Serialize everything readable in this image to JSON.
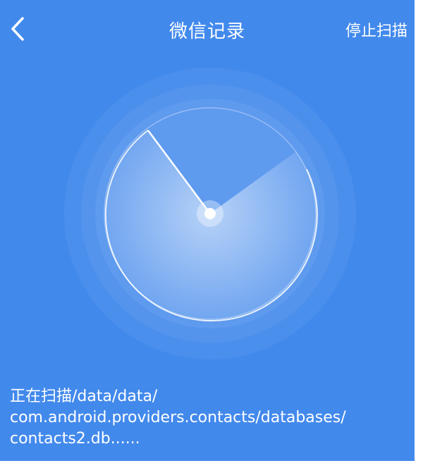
{
  "header": {
    "back_icon": "chevron-left-icon",
    "title": "微信记录",
    "stop_label": "停止扫描"
  },
  "radar": {
    "icon": "radar-scan-icon"
  },
  "status": {
    "line1": "正在扫描/data/data/",
    "line2": "com.android.providers.contacts/databases/",
    "line3": "contacts2.db......"
  },
  "colors": {
    "background": "#4289ec",
    "text": "#ffffff"
  }
}
